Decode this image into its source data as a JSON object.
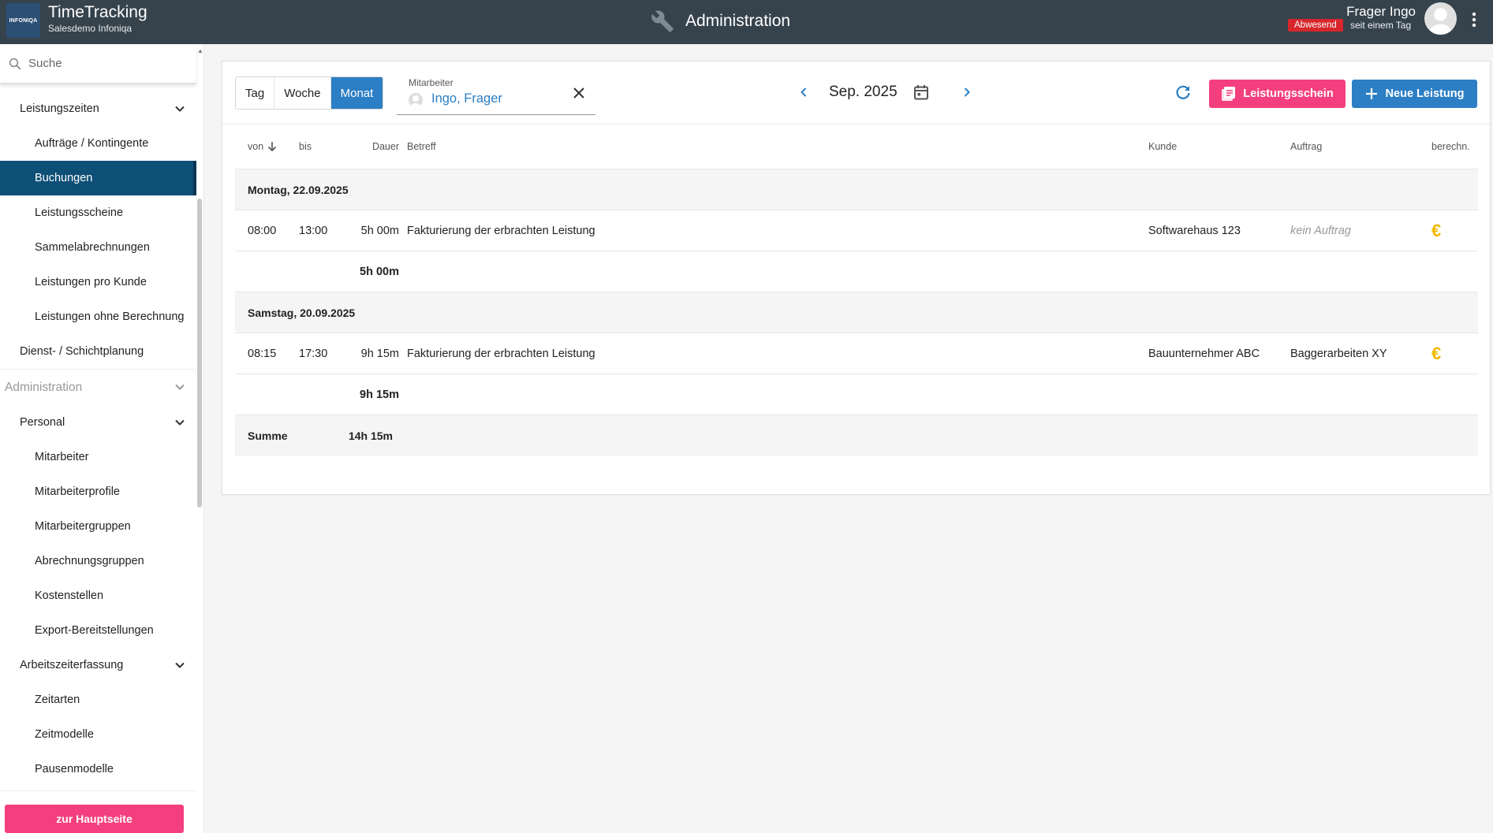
{
  "header": {
    "logo_text": "INFONIQA",
    "app_title": "TimeTracking",
    "app_subtitle": "Salesdemo Infoniqa",
    "section_title": "Administration",
    "user_name": "Frager Ingo",
    "status_badge": "Abwesend",
    "status_since": "seit einem Tag"
  },
  "sidebar": {
    "search_placeholder": "Suche",
    "items": [
      {
        "label": "Leistungszeiten",
        "level": 1,
        "expandable": true
      },
      {
        "label": "Aufträge / Kontingente",
        "level": 2
      },
      {
        "label": "Buchungen",
        "level": 2,
        "active": true
      },
      {
        "label": "Leistungsscheine",
        "level": 2
      },
      {
        "label": "Sammelabrechnungen",
        "level": 2
      },
      {
        "label": "Leistungen pro Kunde",
        "level": 2
      },
      {
        "label": "Leistungen ohne Berechnung",
        "level": 2
      },
      {
        "label": "Dienst- / Schichtplanung",
        "level": 1
      },
      {
        "label": "Administration",
        "level": 0,
        "expandable": true
      },
      {
        "label": "Personal",
        "level": 1,
        "expandable": true
      },
      {
        "label": "Mitarbeiter",
        "level": 2
      },
      {
        "label": "Mitarbeiterprofile",
        "level": 2
      },
      {
        "label": "Mitarbeitergruppen",
        "level": 2
      },
      {
        "label": "Abrechnungsgruppen",
        "level": 2
      },
      {
        "label": "Kostenstellen",
        "level": 2
      },
      {
        "label": "Export-Bereitstellungen",
        "level": 2
      },
      {
        "label": "Arbeitszeiterfassung",
        "level": 1,
        "expandable": true
      },
      {
        "label": "Zeitarten",
        "level": 2
      },
      {
        "label": "Zeitmodelle",
        "level": 2
      },
      {
        "label": "Pausenmodelle",
        "level": 2
      }
    ],
    "home_button": "zur Hauptseite"
  },
  "toolbar": {
    "view_tabs": [
      "Tag",
      "Woche",
      "Monat"
    ],
    "active_view": "Monat",
    "employee_label": "Mitarbeiter",
    "employee_value": "Ingo, Frager",
    "period_label": "Sep. 2025",
    "btn_leistungsschein": "Leistungsschein",
    "btn_neue_leistung": "Neue Leistung"
  },
  "table": {
    "columns": {
      "von": "von",
      "bis": "bis",
      "dauer": "Dauer",
      "betreff": "Betreff",
      "kunde": "Kunde",
      "auftrag": "Auftrag",
      "berechnet": "berechn."
    },
    "groups": [
      {
        "date": "Montag, 22.09.2025",
        "rows": [
          {
            "von": "08:00",
            "bis": "13:00",
            "dauer": "5h 00m",
            "betreff": "Fakturierung der erbrachten Leistung",
            "kunde": "Softwarehaus 123",
            "auftrag": "kein Auftrag",
            "billable": "€"
          }
        ],
        "subtotal": "5h 00m"
      },
      {
        "date": "Samstag, 20.09.2025",
        "rows": [
          {
            "von": "08:15",
            "bis": "17:30",
            "dauer": "9h 15m",
            "betreff": "Fakturierung der erbrachten Leistung",
            "kunde": "Bauunternehmer ABC",
            "auftrag": "Baggerarbeiten XY",
            "billable": "€"
          }
        ],
        "subtotal": "9h 15m"
      }
    ],
    "total_label": "Summe",
    "total_value": "14h 15m"
  },
  "colors": {
    "header_bg": "#36434d",
    "accent_blue": "#2c7fc4",
    "accent_pink": "#f43f7e",
    "active_nav": "#0e4f76",
    "euro": "#f5b800"
  }
}
